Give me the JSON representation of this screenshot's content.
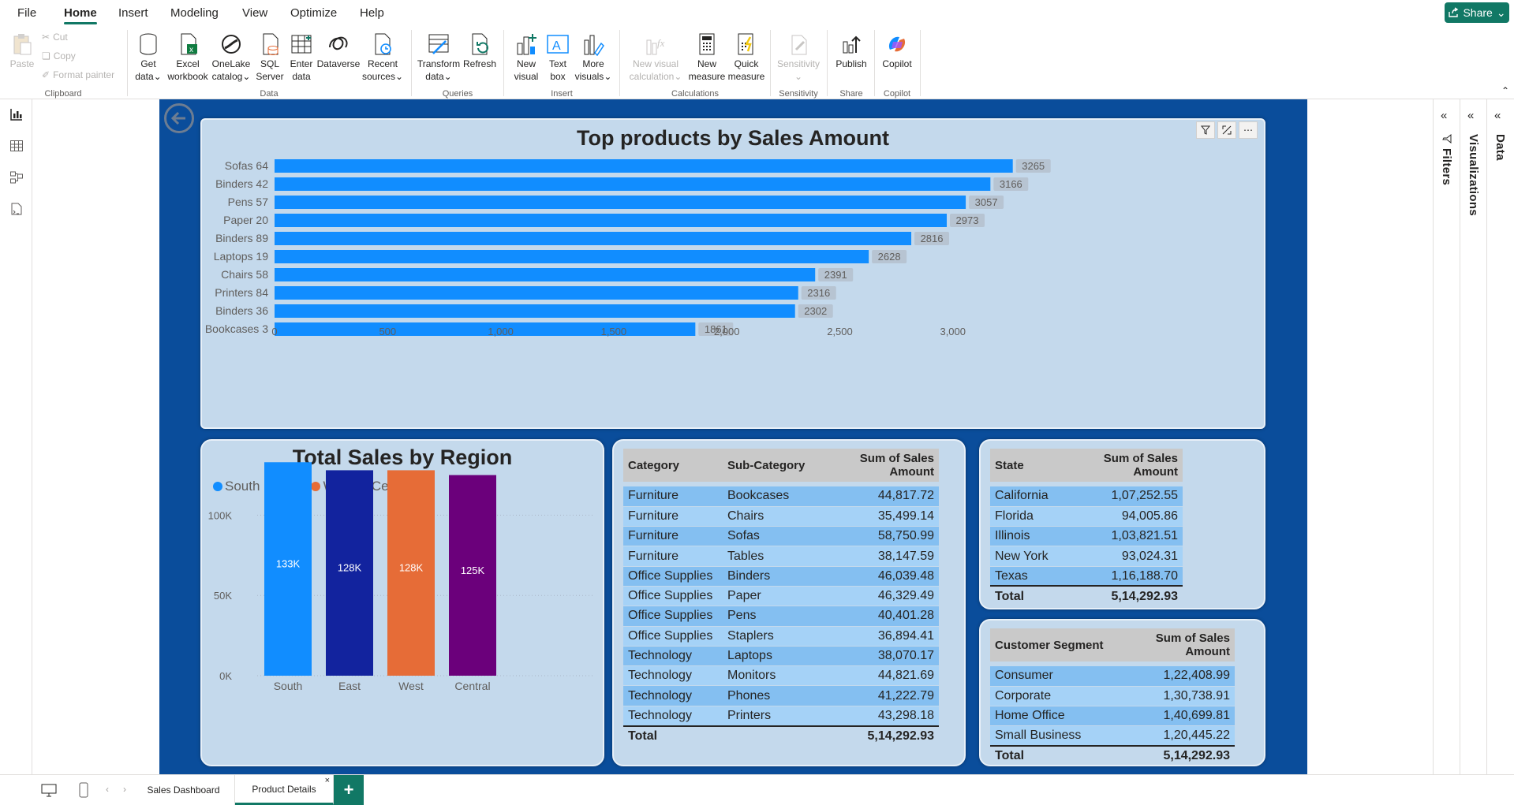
{
  "menu": [
    "File",
    "Home",
    "Insert",
    "Modeling",
    "View",
    "Optimize",
    "Help"
  ],
  "share_label": "Share",
  "ribbon": {
    "clipboard": {
      "paste": "Paste",
      "cut": "Cut",
      "copy": "Copy",
      "format_painter": "Format painter",
      "label": "Clipboard"
    },
    "data": {
      "get_data": [
        "Get",
        "data"
      ],
      "excel": [
        "Excel",
        "workbook"
      ],
      "onelake": [
        "OneLake",
        "catalog"
      ],
      "sql": [
        "SQL",
        "Server"
      ],
      "enter": [
        "Enter",
        "data"
      ],
      "dataverse": [
        "Dataverse",
        ""
      ],
      "recent": [
        "Recent",
        "sources"
      ],
      "label": "Data"
    },
    "queries": {
      "transform": [
        "Transform",
        "data"
      ],
      "refresh": [
        "Refresh",
        ""
      ],
      "label": "Queries"
    },
    "insert": {
      "new_visual": [
        "New",
        "visual"
      ],
      "text_box": [
        "Text",
        "box"
      ],
      "more_visuals": [
        "More",
        "visuals"
      ],
      "label": "Insert"
    },
    "calculations": {
      "new_visual_calc": [
        "New visual",
        "calculation"
      ],
      "new_measure": [
        "New",
        "measure"
      ],
      "quick_measure": [
        "Quick",
        "measure"
      ],
      "label": "Calculations"
    },
    "sensitivity": {
      "sensitivity": [
        "Sensitivity",
        ""
      ],
      "label": "Sensitivity"
    },
    "share": {
      "publish": [
        "Publish",
        ""
      ],
      "label": "Share"
    },
    "copilot": {
      "copilot": [
        "Copilot",
        ""
      ],
      "label": "Copilot"
    }
  },
  "right_panes": {
    "filters": "Filters",
    "visualizations": "Visualizations",
    "data": "Data"
  },
  "pages": [
    "Sales Dashboard",
    "Product Details"
  ],
  "active_page": "Product Details",
  "chart_data": [
    {
      "type": "bar",
      "orientation": "horizontal",
      "title": "Top products by Sales Amount",
      "categories": [
        "Sofas 64",
        "Binders 42",
        "Pens 57",
        "Paper 20",
        "Binders 89",
        "Laptops 19",
        "Chairs 58",
        "Printers 84",
        "Binders 36",
        "Bookcases 3"
      ],
      "values": [
        3265,
        3166,
        3057,
        2973,
        2816,
        2628,
        2391,
        2316,
        2302,
        1861
      ],
      "data_labels": [
        "3265",
        "3166",
        "3057",
        "2973",
        "2816",
        "2628",
        "2391",
        "2316",
        "2302",
        "1861"
      ],
      "xticks": [
        "0",
        "500",
        "1,000",
        "1,500",
        "2,000",
        "2,500",
        "3,000"
      ],
      "xlim": [
        0,
        3280
      ],
      "color": "#118dff",
      "xlabel": "",
      "ylabel": ""
    },
    {
      "type": "bar",
      "title": "Total Sales by Region",
      "categories": [
        "South",
        "East",
        "West",
        "Central"
      ],
      "values": [
        133000,
        128000,
        128000,
        125000
      ],
      "data_labels": [
        "133K",
        "128K",
        "128K",
        "125K"
      ],
      "colors": [
        "#118dff",
        "#12239e",
        "#e66c37",
        "#6b007b"
      ],
      "legend": [
        "South",
        "East",
        "West",
        "Central"
      ],
      "legend_position": "top-left",
      "yticks": [
        "0K",
        "50K",
        "100K"
      ],
      "ylim": [
        0,
        140000
      ],
      "xlabel": "",
      "ylabel": ""
    }
  ],
  "category_table": {
    "headers": [
      "Category",
      "Sub-Category",
      "Sum of Sales Amount"
    ],
    "rows": [
      [
        "Furniture",
        "Bookcases",
        "44,817.72"
      ],
      [
        "Furniture",
        "Chairs",
        "35,499.14"
      ],
      [
        "Furniture",
        "Sofas",
        "58,750.99"
      ],
      [
        "Furniture",
        "Tables",
        "38,147.59"
      ],
      [
        "Office Supplies",
        "Binders",
        "46,039.48"
      ],
      [
        "Office Supplies",
        "Paper",
        "46,329.49"
      ],
      [
        "Office Supplies",
        "Pens",
        "40,401.28"
      ],
      [
        "Office Supplies",
        "Staplers",
        "36,894.41"
      ],
      [
        "Technology",
        "Laptops",
        "38,070.17"
      ],
      [
        "Technology",
        "Monitors",
        "44,821.69"
      ],
      [
        "Technology",
        "Phones",
        "41,222.79"
      ],
      [
        "Technology",
        "Printers",
        "43,298.18"
      ]
    ],
    "total_label": "Total",
    "total_value": "5,14,292.93"
  },
  "state_table": {
    "headers": [
      "State",
      "Sum of Sales Amount"
    ],
    "rows": [
      [
        "California",
        "1,07,252.55"
      ],
      [
        "Florida",
        "94,005.86"
      ],
      [
        "Illinois",
        "1,03,821.51"
      ],
      [
        "New York",
        "93,024.31"
      ],
      [
        "Texas",
        "1,16,188.70"
      ]
    ],
    "total_label": "Total",
    "total_value": "5,14,292.93"
  },
  "segment_table": {
    "headers": [
      "Customer Segment",
      "Sum of Sales Amount"
    ],
    "rows": [
      [
        "Consumer",
        "1,22,408.99"
      ],
      [
        "Corporate",
        "1,30,738.91"
      ],
      [
        "Home Office",
        "1,40,699.81"
      ],
      [
        "Small Business",
        "1,20,445.22"
      ]
    ],
    "total_label": "Total",
    "total_value": "5,14,292.93"
  }
}
